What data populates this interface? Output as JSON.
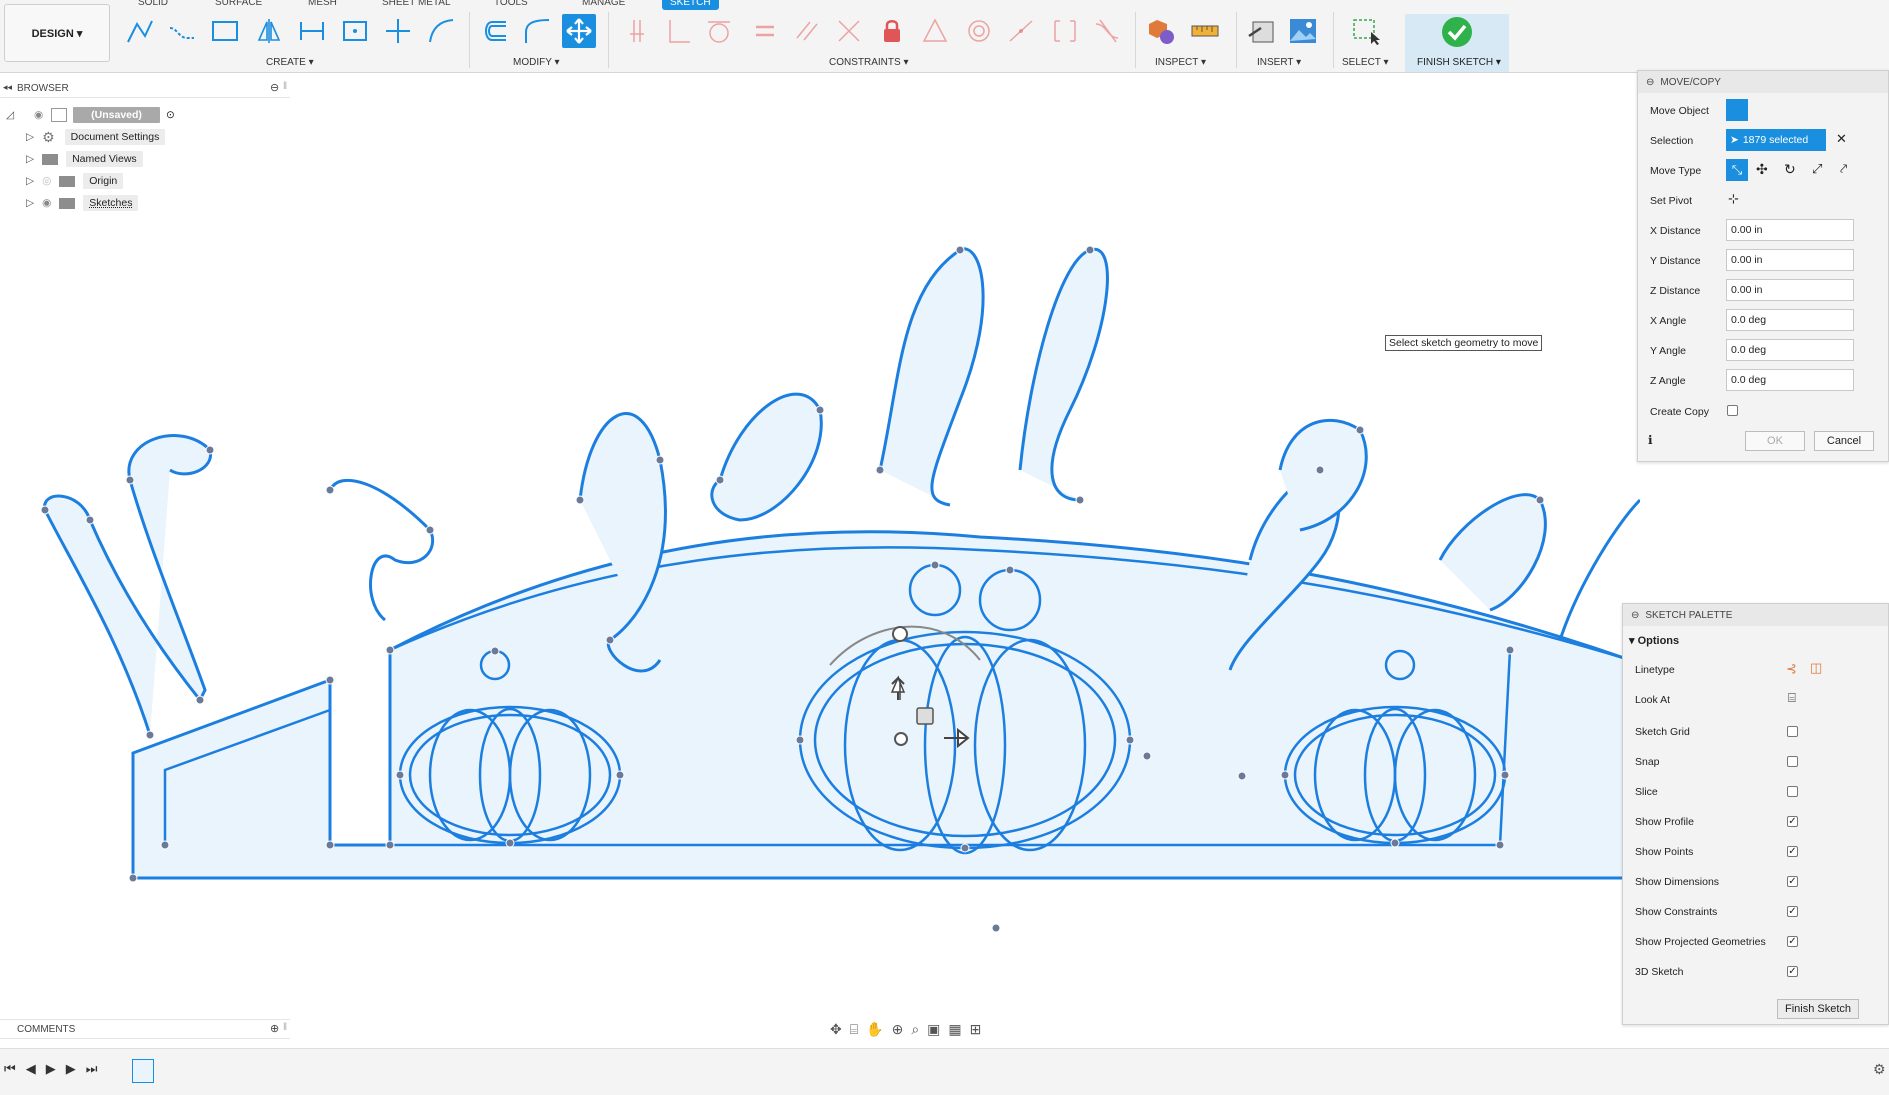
{
  "toolbar": {
    "design_label": "DESIGN ▾",
    "tabs": [
      "SOLID",
      "SURFACE",
      "MESH",
      "SHEET METAL",
      "TOOLS",
      "MANAGE",
      "SKETCH"
    ],
    "groups": {
      "create": "CREATE ▾",
      "modify": "MODIFY ▾",
      "constraints": "CONSTRAINTS ▾",
      "inspect": "INSPECT ▾",
      "insert": "INSERT ▾",
      "select": "SELECT ▾",
      "finish_sketch": "FINISH SKETCH ▾"
    }
  },
  "browser": {
    "title": "BROWSER",
    "items": [
      {
        "label": "(Unsaved)"
      },
      {
        "label": "Document Settings"
      },
      {
        "label": "Named Views"
      },
      {
        "label": "Origin"
      },
      {
        "label": "Sketches"
      }
    ]
  },
  "comments": {
    "title": "COMMENTS"
  },
  "canvas": {
    "tooltip": "Select sketch geometry to move"
  },
  "move_copy": {
    "title": "MOVE/COPY",
    "move_object_label": "Move Object",
    "selection_label": "Selection",
    "selection_value": "1879 selected",
    "move_type_label": "Move Type",
    "set_pivot_label": "Set Pivot",
    "fields": [
      {
        "label": "X Distance",
        "value": "0.00 in"
      },
      {
        "label": "Y Distance",
        "value": "0.00 in"
      },
      {
        "label": "Z Distance",
        "value": "0.00 in"
      },
      {
        "label": "X Angle",
        "value": "0.0 deg"
      },
      {
        "label": "Y Angle",
        "value": "0.0 deg"
      },
      {
        "label": "Z Angle",
        "value": "0.0 deg"
      }
    ],
    "create_copy_label": "Create Copy",
    "ok_label": "OK",
    "cancel_label": "Cancel"
  },
  "sketch_palette": {
    "title": "SKETCH PALETTE",
    "options_label": "Options",
    "linetype_label": "Linetype",
    "look_at_label": "Look At",
    "options": [
      {
        "label": "Sketch Grid",
        "checked": false
      },
      {
        "label": "Snap",
        "checked": false
      },
      {
        "label": "Slice",
        "checked": false
      },
      {
        "label": "Show Profile",
        "checked": true
      },
      {
        "label": "Show Points",
        "checked": true
      },
      {
        "label": "Show Dimensions",
        "checked": true
      },
      {
        "label": "Show Constraints",
        "checked": true
      },
      {
        "label": "Show Projected Geometries",
        "checked": true
      },
      {
        "label": "3D Sketch",
        "checked": true
      }
    ],
    "finish_label": "Finish Sketch"
  },
  "colors": {
    "accent": "#1a8fe0",
    "sketch_line": "#1c7fe0",
    "profile_fill": "#eaf4fc",
    "point": "#6a7a99"
  }
}
